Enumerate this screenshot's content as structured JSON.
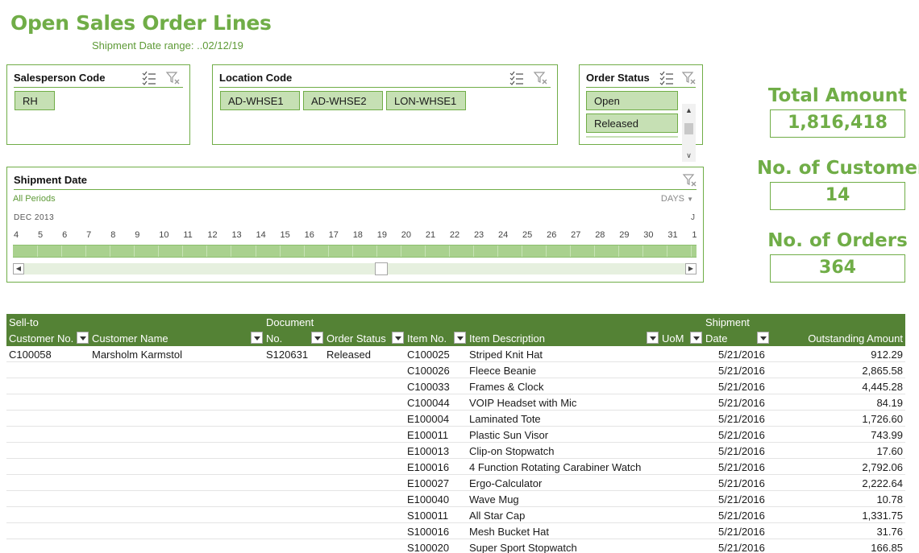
{
  "header": {
    "title": "Open Sales Order Lines",
    "subtitle": "Shipment Date range:  ..02/12/19"
  },
  "slicers": {
    "salesperson": {
      "title": "Salesperson Code",
      "items": [
        "RH"
      ]
    },
    "location": {
      "title": "Location Code",
      "items": [
        "AD-WHSE1",
        "AD-WHSE2",
        "LON-WHSE1"
      ]
    },
    "order_status": {
      "title": "Order Status",
      "items": [
        "Open",
        "Released"
      ]
    }
  },
  "timeline": {
    "title": "Shipment Date",
    "periods_label": "All Periods",
    "level_label": "DAYS",
    "month_label": "DEC 2013",
    "next_month_label": "J",
    "days": [
      "4",
      "5",
      "6",
      "7",
      "8",
      "9",
      "10",
      "11",
      "12",
      "13",
      "14",
      "15",
      "16",
      "17",
      "18",
      "19",
      "20",
      "21",
      "22",
      "23",
      "24",
      "25",
      "26",
      "27",
      "28",
      "29",
      "30",
      "31",
      "1"
    ],
    "scroll_position": 0.54
  },
  "kpis": {
    "total_amount": {
      "label": "Total Amount",
      "value": "1,816,418"
    },
    "customers": {
      "label": "No. of Customers",
      "value": "14"
    },
    "orders": {
      "label": "No. of Orders",
      "value": "364"
    }
  },
  "table": {
    "headers": {
      "customer_no_1": "Sell-to",
      "customer_no_2": "Customer No.",
      "customer_name": "Customer Name",
      "document_1": "Document",
      "document_2": "No.",
      "order_status": "Order Status",
      "item_no": "Item No.",
      "item_desc": "Item Description",
      "uom": "UoM",
      "ship_1": "Shipment",
      "ship_2": "Date",
      "amount": "Outstanding Amount"
    },
    "rows": [
      {
        "customer_no": "C100058",
        "customer_name": "Marsholm Karmstol",
        "document_no": "S120631",
        "order_status": "Released",
        "item_no": "C100025",
        "item_desc": "Striped Knit Hat",
        "uom": "",
        "ship_date": "5/21/2016",
        "amount": "912.29"
      },
      {
        "customer_no": "",
        "customer_name": "",
        "document_no": "",
        "order_status": "",
        "item_no": "C100026",
        "item_desc": "Fleece Beanie",
        "uom": "",
        "ship_date": "5/21/2016",
        "amount": "2,865.58"
      },
      {
        "customer_no": "",
        "customer_name": "",
        "document_no": "",
        "order_status": "",
        "item_no": "C100033",
        "item_desc": "Frames & Clock",
        "uom": "",
        "ship_date": "5/21/2016",
        "amount": "4,445.28"
      },
      {
        "customer_no": "",
        "customer_name": "",
        "document_no": "",
        "order_status": "",
        "item_no": "C100044",
        "item_desc": "VOIP Headset with Mic",
        "uom": "",
        "ship_date": "5/21/2016",
        "amount": "84.19"
      },
      {
        "customer_no": "",
        "customer_name": "",
        "document_no": "",
        "order_status": "",
        "item_no": "E100004",
        "item_desc": "Laminated Tote",
        "uom": "",
        "ship_date": "5/21/2016",
        "amount": "1,726.60"
      },
      {
        "customer_no": "",
        "customer_name": "",
        "document_no": "",
        "order_status": "",
        "item_no": "E100011",
        "item_desc": "Plastic Sun Visor",
        "uom": "",
        "ship_date": "5/21/2016",
        "amount": "743.99"
      },
      {
        "customer_no": "",
        "customer_name": "",
        "document_no": "",
        "order_status": "",
        "item_no": "E100013",
        "item_desc": "Clip-on Stopwatch",
        "uom": "",
        "ship_date": "5/21/2016",
        "amount": "17.60"
      },
      {
        "customer_no": "",
        "customer_name": "",
        "document_no": "",
        "order_status": "",
        "item_no": "E100016",
        "item_desc": "4 Function Rotating Carabiner Watch",
        "uom": "",
        "ship_date": "5/21/2016",
        "amount": "2,792.06"
      },
      {
        "customer_no": "",
        "customer_name": "",
        "document_no": "",
        "order_status": "",
        "item_no": "E100027",
        "item_desc": "Ergo-Calculator",
        "uom": "",
        "ship_date": "5/21/2016",
        "amount": "2,222.64"
      },
      {
        "customer_no": "",
        "customer_name": "",
        "document_no": "",
        "order_status": "",
        "item_no": "E100040",
        "item_desc": "Wave Mug",
        "uom": "",
        "ship_date": "5/21/2016",
        "amount": "10.78"
      },
      {
        "customer_no": "",
        "customer_name": "",
        "document_no": "",
        "order_status": "",
        "item_no": "S100011",
        "item_desc": "All Star Cap",
        "uom": "",
        "ship_date": "5/21/2016",
        "amount": "1,331.75"
      },
      {
        "customer_no": "",
        "customer_name": "",
        "document_no": "",
        "order_status": "",
        "item_no": "S100016",
        "item_desc": "Mesh Bucket Hat",
        "uom": "",
        "ship_date": "5/21/2016",
        "amount": "31.76"
      },
      {
        "customer_no": "",
        "customer_name": "",
        "document_no": "",
        "order_status": "",
        "item_no": "S100020",
        "item_desc": "Super Sport Stopwatch",
        "uom": "",
        "ship_date": "5/21/2016",
        "amount": "166.85"
      }
    ]
  }
}
